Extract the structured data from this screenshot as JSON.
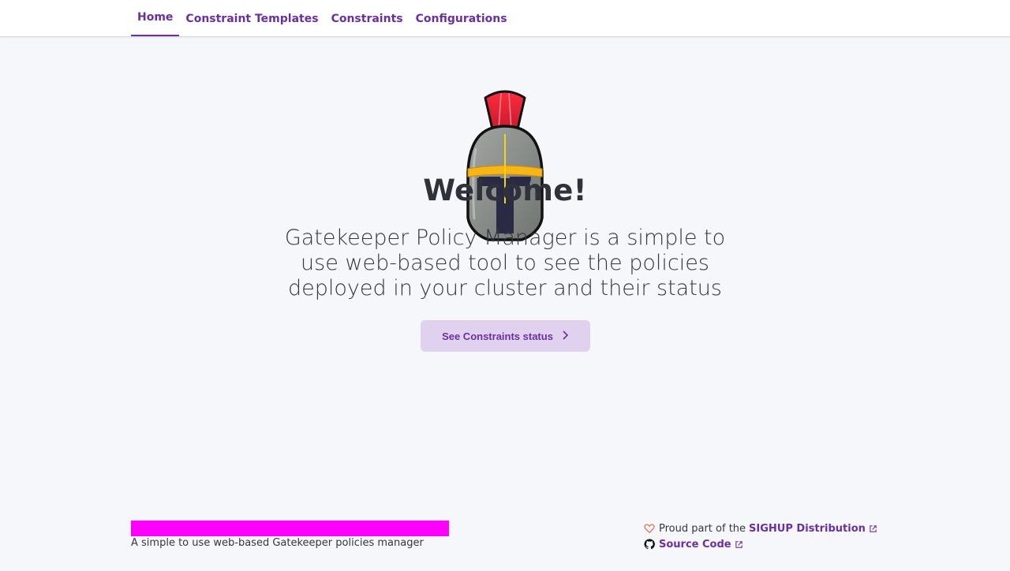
{
  "nav": {
    "tabs": [
      {
        "label": "Home",
        "active": true
      },
      {
        "label": "Constraint Templates",
        "active": false
      },
      {
        "label": "Constraints",
        "active": false
      },
      {
        "label": "Configurations",
        "active": false
      }
    ]
  },
  "hero": {
    "logo_icon": "spartan-helmet-icon",
    "title": "Welcome!",
    "subtitle": "Gatekeeper Policy Manager is a simple to use web-based tool to see the policies deployed in your cluster and their status",
    "cta_label": "See Constraints status",
    "cta_icon": "chevron-right-icon"
  },
  "footer": {
    "description": "A simple to use web-based Gatekeeper policies manager",
    "proud_text": "Proud part of the",
    "proud_link": "SIGHUP Distribution",
    "source_link": "Source Code",
    "heart_icon": "heart-icon",
    "github_icon": "github-icon",
    "external_icon": "external-link-icon"
  },
  "colors": {
    "accent": "#6b2fa0",
    "button_bg": "#e0d1ee",
    "background": "#f5f7fa",
    "banner": "#ff00ff",
    "heart": "#e7664c"
  }
}
